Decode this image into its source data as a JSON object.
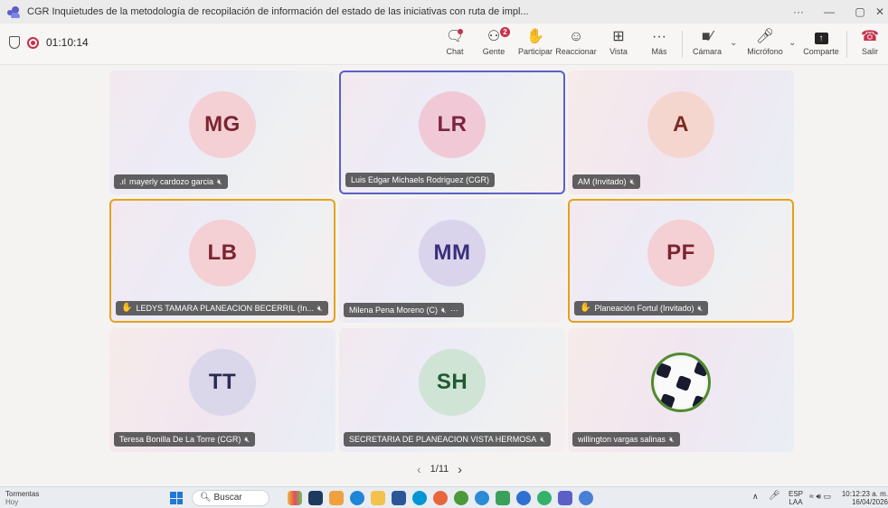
{
  "window": {
    "title": "CGR Inquietudes de la metodología de recopilación de información del estado de las iniciativas con ruta de impl...",
    "more": "···",
    "minimize": "—",
    "maximize": "▢",
    "close": "✕"
  },
  "meeting": {
    "timer": "01:10:14",
    "toolbar": [
      {
        "label": "Chat",
        "icon": "chat-icon"
      },
      {
        "label": "Gente",
        "icon": "people-icon",
        "badge": "2"
      },
      {
        "label": "Participar",
        "icon": "raise-hand-icon"
      },
      {
        "label": "Reaccionar",
        "icon": "emoji-icon"
      },
      {
        "label": "Vista",
        "icon": "view-grid-icon"
      },
      {
        "label": "Más",
        "icon": "more-icon"
      },
      {
        "label": "Cámara",
        "icon": "camera-off-icon"
      },
      {
        "label": "Micrófono",
        "icon": "mic-off-icon"
      },
      {
        "label": "Comparte",
        "icon": "share-icon"
      },
      {
        "label": "Salir",
        "icon": "hangup-icon"
      }
    ],
    "colors": {
      "accent": "#5b5fc7",
      "hand_raised": "#e5a11c",
      "hangup": "#c4314b"
    }
  },
  "participants": [
    {
      "initials": "MG",
      "name": "mayerly cardozo garcia"
    },
    {
      "initials": "LR",
      "name": "Luis Edgar Michaels Rodriguez (CGR)"
    },
    {
      "initials": "A",
      "name": "AM (Invitado)"
    },
    {
      "initials": "LB",
      "name": "LEDYS TAMARA PLANEACION BECERRIL (In..."
    },
    {
      "initials": "MM",
      "name": "Milena Pena Moreno (C)",
      "extra": "···"
    },
    {
      "initials": "PF",
      "name": "Planeación Fortul (Invitado)"
    },
    {
      "initials": "TT",
      "name": "Teresa Bonilla De La Torre (CGR)"
    },
    {
      "initials": "SH",
      "name": "SECRETARIA DE PLANEACION VISTA HERMOSA"
    },
    {
      "initials": "",
      "name": "willington vargas salinas"
    }
  ],
  "pager": {
    "prev": "‹",
    "label": "1/11",
    "next": "›"
  },
  "taskbar": {
    "weather_title": "Tormentas",
    "weather_sub": "Hoy",
    "search": "Buscar",
    "lang": "ESP",
    "lang_sub": "LAA",
    "time": "10:12:23 a. m.",
    "date": "16/04/2026"
  }
}
